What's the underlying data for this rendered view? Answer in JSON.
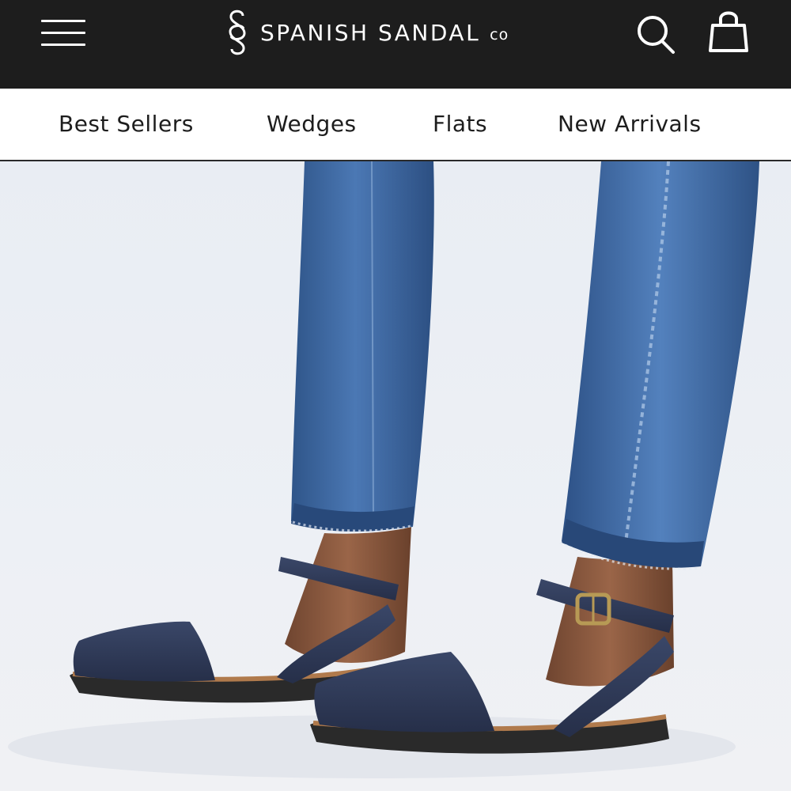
{
  "header": {
    "brand": "SPANISH SANDAL",
    "brand_suffix": "co",
    "background": "#1d1d1d",
    "icons": [
      "menu-icon",
      "search-icon",
      "shopping-bag-icon"
    ]
  },
  "nav": {
    "items": [
      {
        "label": "Best Sellers"
      },
      {
        "label": "Wedges"
      },
      {
        "label": "Flats"
      },
      {
        "label": "New Arrivals"
      }
    ]
  },
  "hero": {
    "colors": {
      "denim": "#3f6aa5",
      "sandal": "#2f3b5a",
      "skin": "#8a5a3f",
      "background": "#ecf0f5"
    }
  }
}
